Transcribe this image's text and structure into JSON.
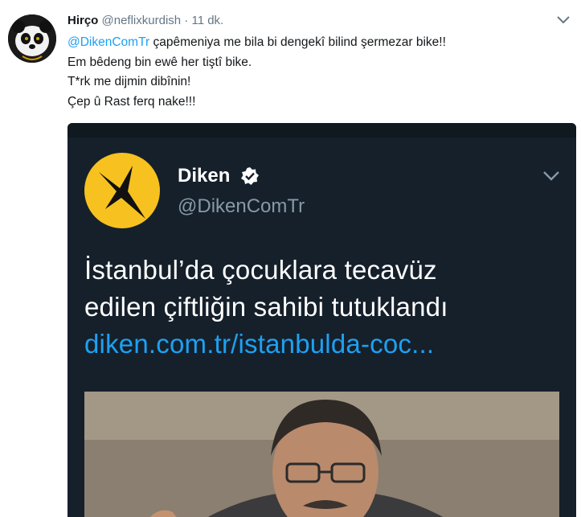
{
  "tweet": {
    "author_name": "Hirço",
    "author_handle": "@neflixkurdish",
    "separator": "·",
    "time": "11 dk.",
    "mention": "@DikenComTr",
    "line1_rest": " çapêmeniya me bila bi dengekî bilind şermezar bike!!",
    "line2": "Em bêdeng bin ewê her tiştî bike.",
    "line3": "T*rk me dijmin dibînin!",
    "line4": "Çep û Rast ferq nake!!!"
  },
  "embedded": {
    "name": "Diken",
    "handle": "@DikenComTr",
    "headline_line1": "İstanbul’da çocuklara tecavüz",
    "headline_line2": "edilen çiftliğin sahibi tutuklandı",
    "link": "diken.com.tr/istanbulda-coc..."
  },
  "colors": {
    "link_blue": "#1da1f2",
    "dark_card": "#15202b",
    "diken_yellow": "#f7c11f",
    "secondary_text": "#657786"
  },
  "icons": [
    "panda-avatar",
    "chevron-down-icon",
    "diken-logo",
    "verified-badge-icon"
  ]
}
